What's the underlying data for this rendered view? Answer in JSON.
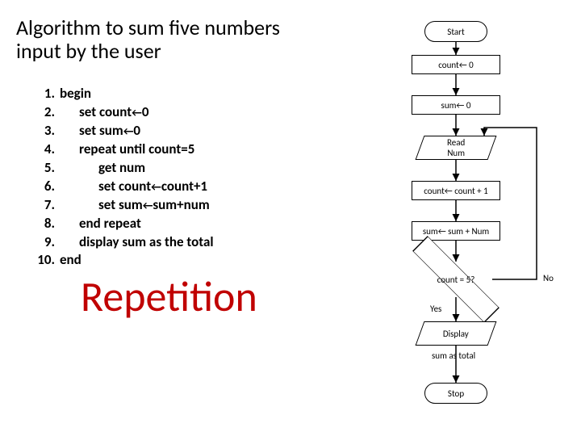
{
  "title": "Algorithm to sum five numbers input by the user",
  "pseudo": [
    {
      "n": "1.",
      "indent": 0,
      "text": "begin"
    },
    {
      "n": "2.",
      "indent": 1,
      "text": "set count←0"
    },
    {
      "n": "3.",
      "indent": 1,
      "text": "set sum←0"
    },
    {
      "n": "4.",
      "indent": 1,
      "text": "repeat until count=5"
    },
    {
      "n": "5.",
      "indent": 2,
      "text": "get num"
    },
    {
      "n": "6.",
      "indent": 2,
      "text": "set count←count+1"
    },
    {
      "n": "7.",
      "indent": 2,
      "text": "set sum←sum+num"
    },
    {
      "n": "8.",
      "indent": 1,
      "text": "end repeat"
    },
    {
      "n": "9.",
      "indent": 1,
      "text": "display sum as the total"
    },
    {
      "n": "10.",
      "indent": 0,
      "text": "end"
    }
  ],
  "bigword": "Repetition",
  "flow": {
    "start": "Start",
    "init_count": "count← 0",
    "init_sum": "sum← 0",
    "read": "Read\nNum",
    "inc": "count← count + 1",
    "accum": "sum← sum + Num",
    "decision": "count = 5?",
    "yes": "Yes",
    "no": "No",
    "disp1": "Display",
    "disp2": "sum as total",
    "stop": "Stop"
  }
}
